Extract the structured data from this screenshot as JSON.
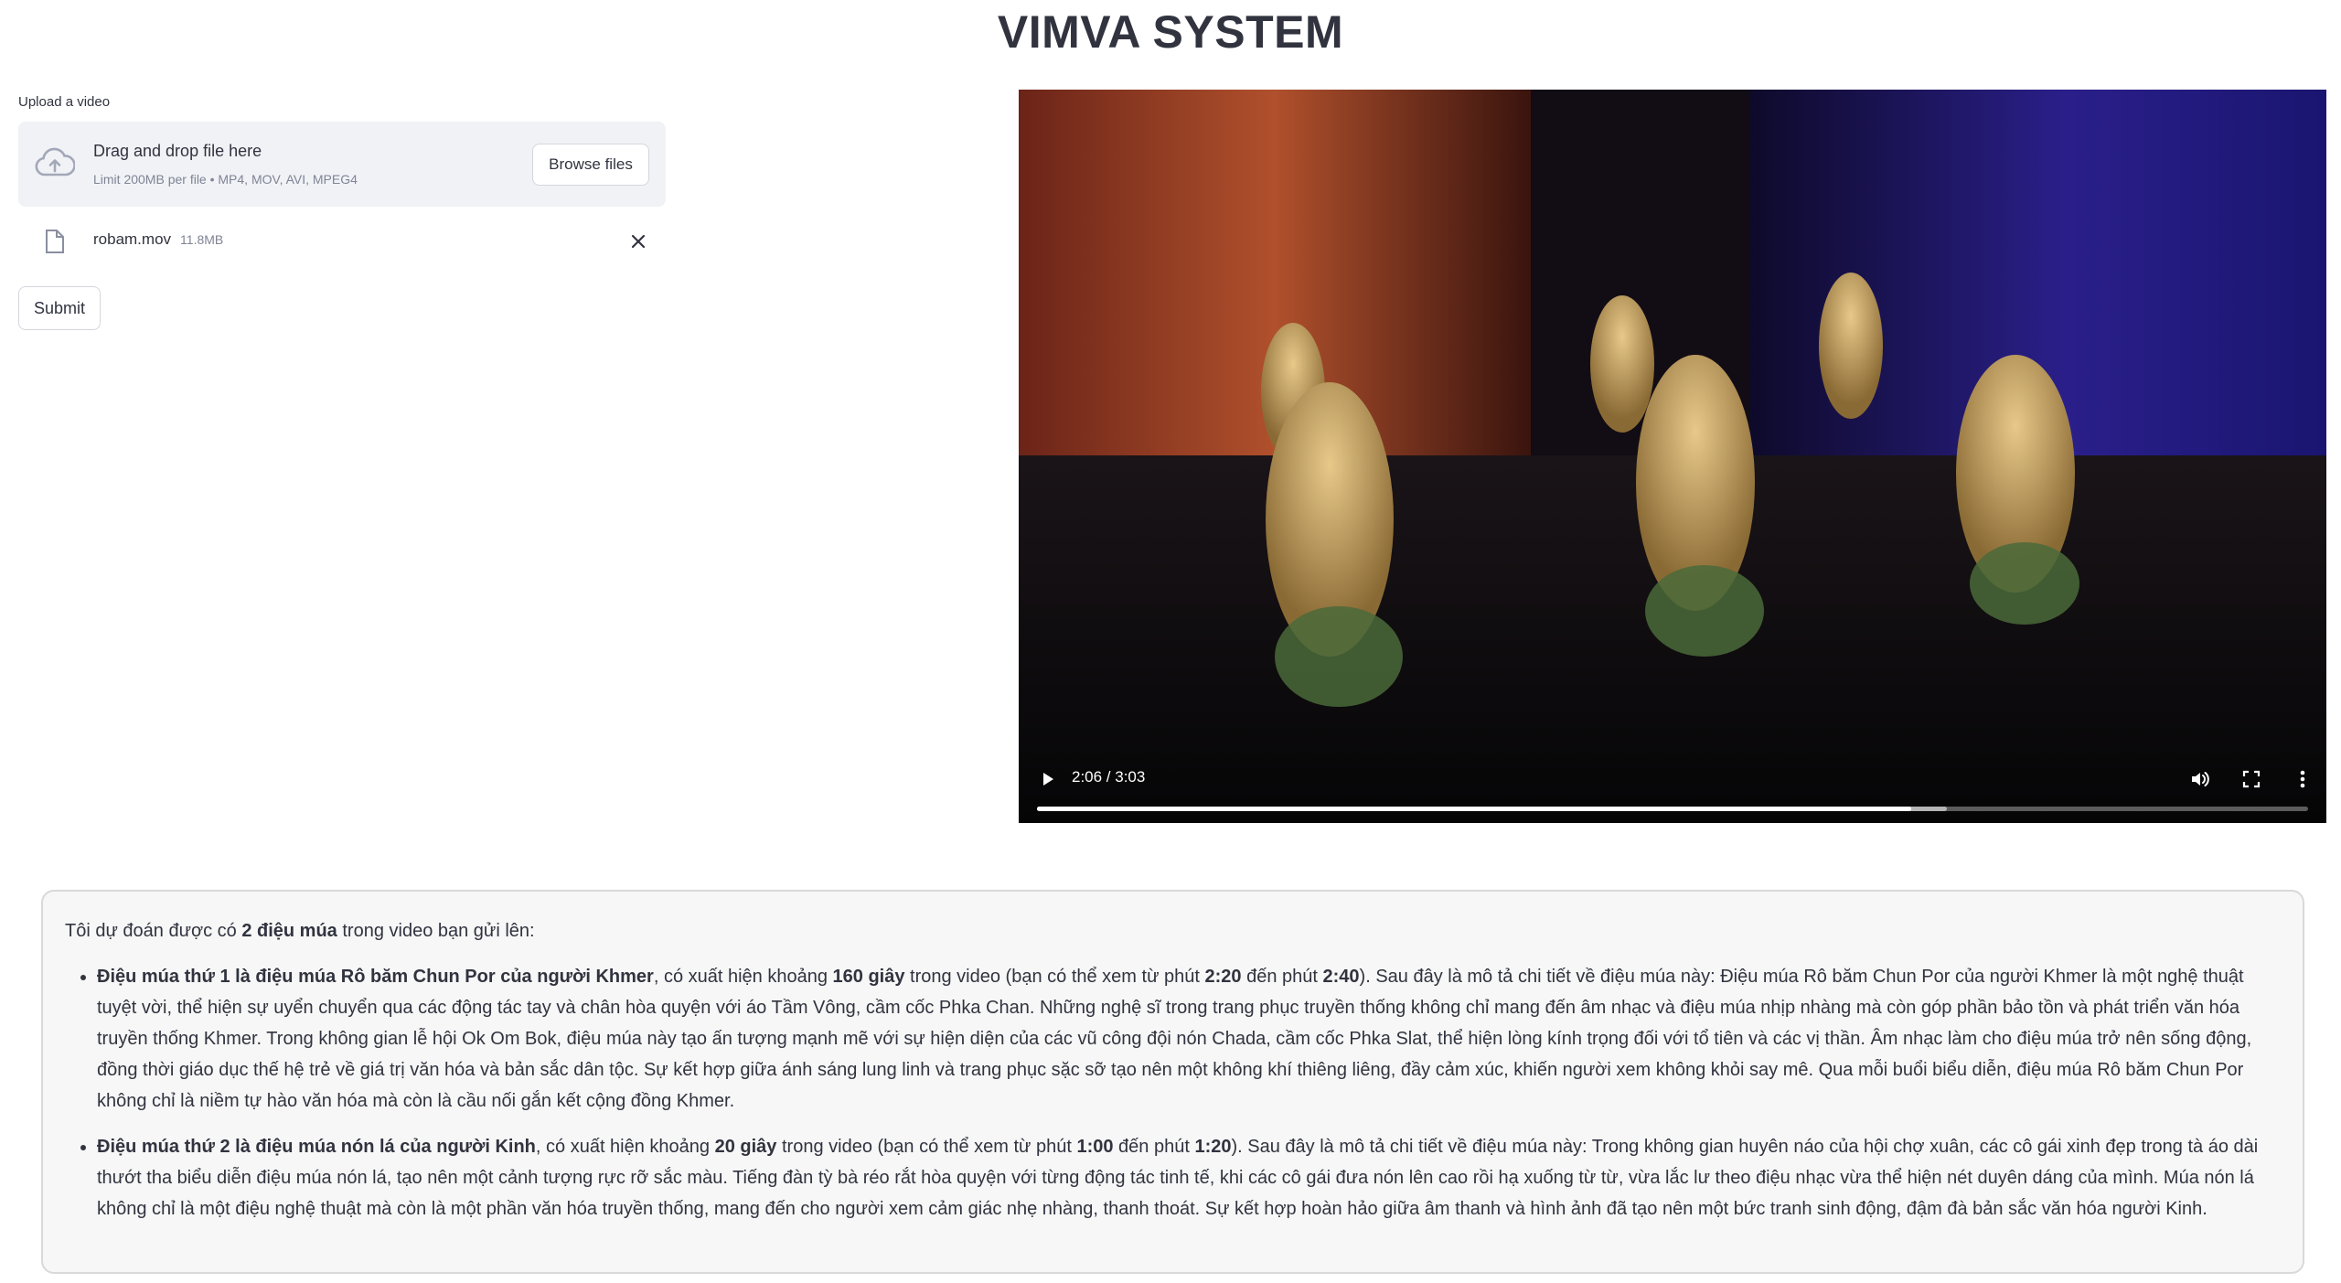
{
  "app": {
    "title": "VIMVA SYSTEM"
  },
  "upload": {
    "label": "Upload a video",
    "drop_text": "Drag and drop file here",
    "limit_text": "Limit 200MB per file • MP4, MOV, AVI, MPEG4",
    "browse_label": "Browse files",
    "file": {
      "name": "robam.mov",
      "size": "11.8MB"
    },
    "submit_label": "Submit"
  },
  "video": {
    "time": "2:06 / 3:03",
    "progress_fraction": 0.688,
    "buffered_fraction": 0.716
  },
  "result": {
    "intro": {
      "prefix": "Tôi dự đoán được có ",
      "count": "2 điệu múa",
      "suffix": " trong video bạn gửi lên:"
    },
    "items": [
      {
        "title": "Điệu múa thứ 1 là điệu múa Rô băm Chun Por của người Khmer",
        "t1": ", có xuất hiện khoảng ",
        "duration": "160 giây",
        "t2": " trong video (bạn có thể xem từ phút ",
        "start": "2:20",
        "t3": " đến phút ",
        "end": "2:40",
        "desc": "). Sau đây là mô tả chi tiết về điệu múa này: Điệu múa Rô băm Chun Por của người Khmer là một nghệ thuật tuyệt vời, thể hiện sự uyển chuyển qua các động tác tay và chân hòa quyện với áo Tầm Vông, cầm cốc Phka Chan. Những nghệ sĩ trong trang phục truyền thống không chỉ mang đến âm nhạc và điệu múa nhịp nhàng mà còn góp phần bảo tồn và phát triển văn hóa truyền thống Khmer. Trong không gian lễ hội Ok Om Bok, điệu múa này tạo ấn tượng mạnh mẽ với sự hiện diện của các vũ công đội nón Chada, cầm cốc Phka Slat, thể hiện lòng kính trọng đối với tổ tiên và các vị thần. Âm nhạc làm cho điệu múa trở nên sống động, đồng thời giáo dục thế hệ trẻ về giá trị văn hóa và bản sắc dân tộc. Sự kết hợp giữa ánh sáng lung linh và trang phục sặc sỡ tạo nên một không khí thiêng liêng, đầy cảm xúc, khiến người xem không khỏi say mê. Qua mỗi buổi biểu diễn, điệu múa Rô băm Chun Por không chỉ là niềm tự hào văn hóa mà còn là cầu nối gắn kết cộng đồng Khmer."
      },
      {
        "title": "Điệu múa thứ 2 là điệu múa nón lá của người Kinh",
        "t1": ", có xuất hiện khoảng ",
        "duration": "20 giây",
        "t2": " trong video (bạn có thể xem từ phút ",
        "start": "1:00",
        "t3": " đến phút ",
        "end": "1:20",
        "desc": "). Sau đây là mô tả chi tiết về điệu múa này: Trong không gian huyên náo của hội chợ xuân, các cô gái xinh đẹp trong tà áo dài thướt tha biểu diễn điệu múa nón lá, tạo nên một cảnh tượng rực rỡ sắc màu. Tiếng đàn tỳ bà réo rắt hòa quyện với từng động tác tinh tế, khi các cô gái đưa nón lên cao rồi hạ xuống từ từ, vừa lắc lư theo điệu nhạc vừa thể hiện nét duyên dáng của mình. Múa nón lá không chỉ là một điệu nghệ thuật mà còn là một phần văn hóa truyền thống, mang đến cho người xem cảm giác nhẹ nhàng, thanh thoát. Sự kết hợp hoàn hảo giữa âm thanh và hình ảnh đã tạo nên một bức tranh sinh động, đậm đà bản sắc văn hóa người Kinh."
      }
    ]
  }
}
